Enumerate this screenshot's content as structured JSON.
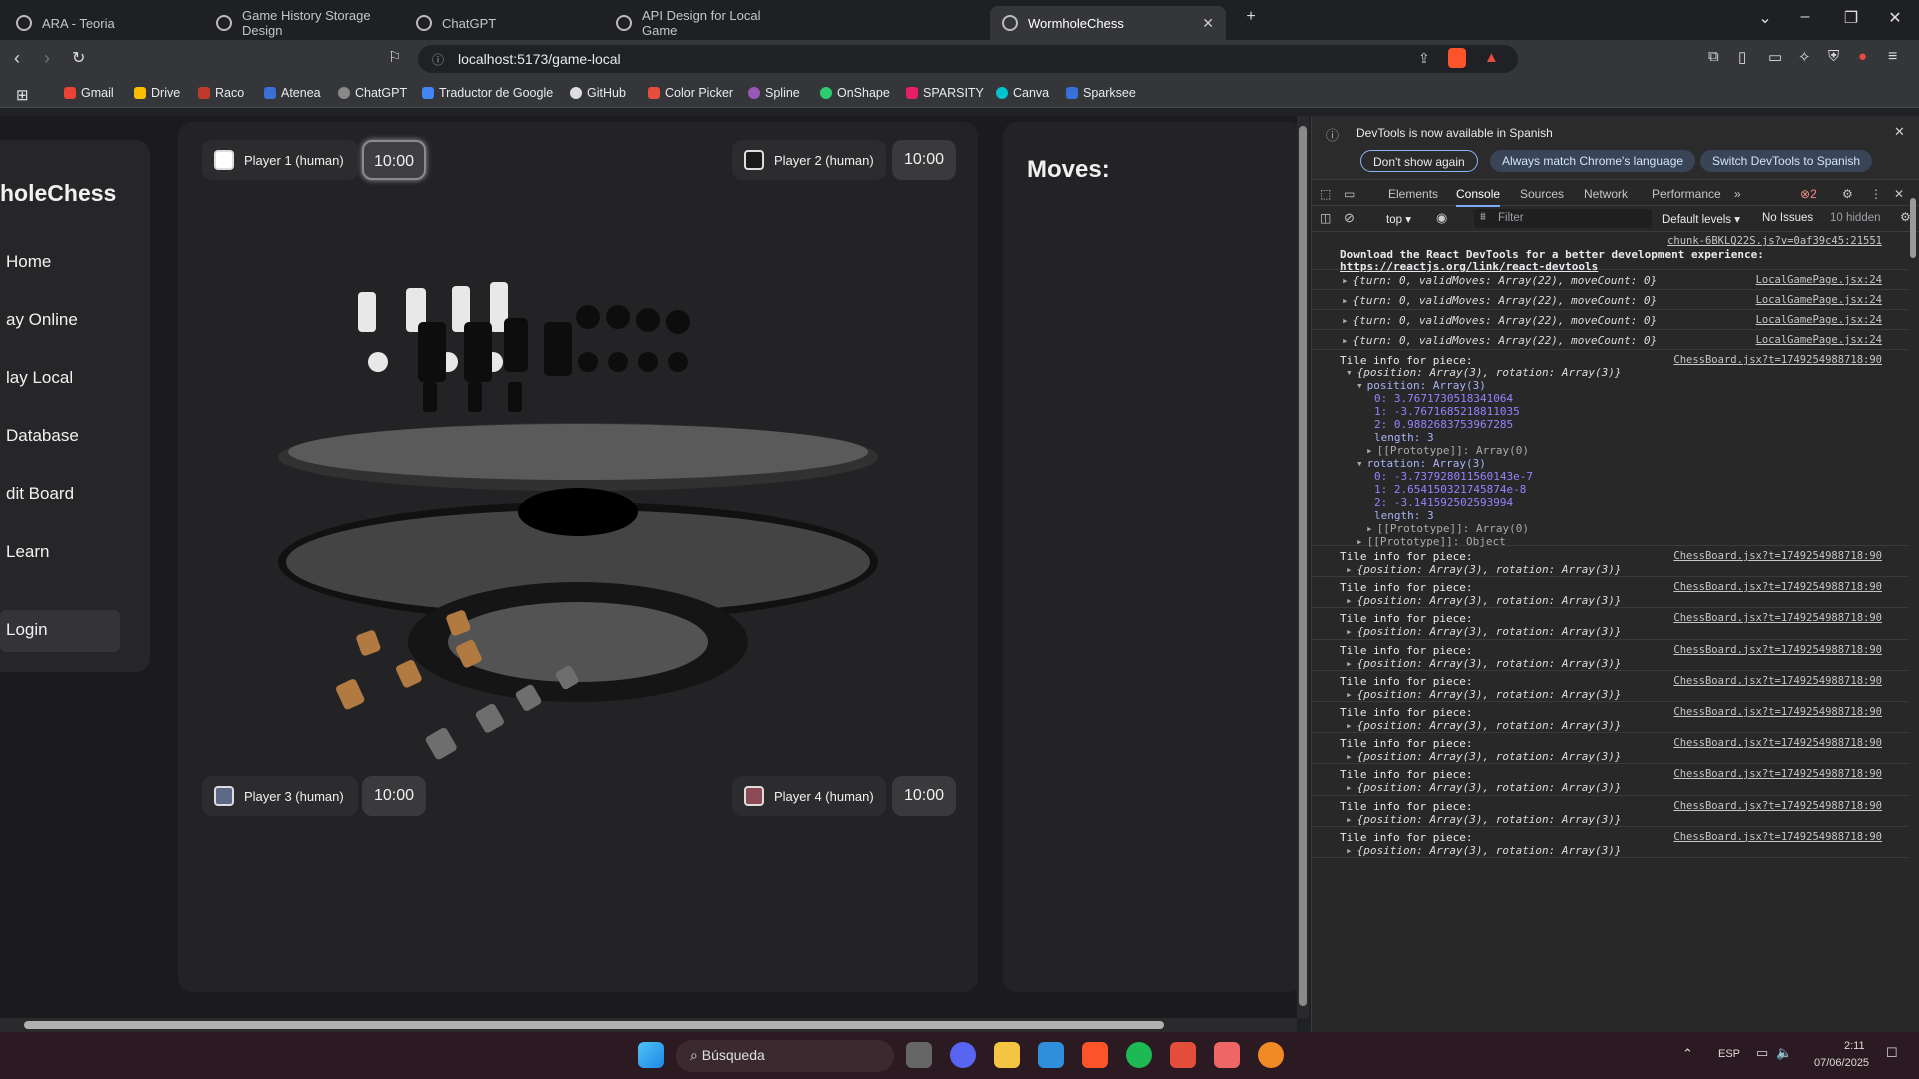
{
  "browser": {
    "tabs": [
      {
        "label": "ARA - Teoria"
      },
      {
        "label": "Game History Storage Design"
      },
      {
        "label": "ChatGPT"
      },
      {
        "label": "API Design for Local Game"
      },
      {
        "label": "WormholeChess"
      }
    ],
    "url": "localhost:5173/game-local",
    "bookmarks": [
      {
        "label": "Gmail"
      },
      {
        "label": "Drive"
      },
      {
        "label": "Raco"
      },
      {
        "label": "Atenea"
      },
      {
        "label": "ChatGPT"
      },
      {
        "label": "Traductor de Google"
      },
      {
        "label": "GitHub"
      },
      {
        "label": "Color Picker"
      },
      {
        "label": "Spline"
      },
      {
        "label": "OnShape"
      },
      {
        "label": "SPARSITY"
      },
      {
        "label": "Canva"
      },
      {
        "label": "Sparksee"
      }
    ]
  },
  "app": {
    "brand": "holeChess",
    "nav": [
      "Home",
      "ay Online",
      "lay Local",
      "Database",
      "dit Board",
      "Learn"
    ],
    "login": "Login",
    "players": [
      {
        "name": "Player 1 (human)",
        "time": "10:00",
        "color": "#ffffff"
      },
      {
        "name": "Player 2 (human)",
        "time": "10:00",
        "color": "#1a1a1a"
      },
      {
        "name": "Player 3 (human)",
        "time": "10:00",
        "color": "#5b6a85"
      },
      {
        "name": "Player 4 (human)",
        "time": "10:00",
        "color": "#8b4a55"
      }
    ],
    "moves_title": "Moves:"
  },
  "devtools": {
    "banner": "DevTools is now available in Spanish",
    "btn_dont_show": "Don't show again",
    "btn_match": "Always match Chrome's language",
    "btn_switch": "Switch DevTools to Spanish",
    "tabs": [
      "Elements",
      "Console",
      "Sources",
      "Network",
      "Performance"
    ],
    "error_count": "2",
    "context": "top",
    "filter_placeholder": "Filter",
    "levels": "Default levels",
    "issues": "No Issues",
    "hidden": "10 hidden",
    "react_src": "chunk-6BKLQ22S.js?v=0af39c45:21551",
    "react_msg1": "Download the React DevTools for a better development experience:",
    "react_msg2": "https://reactjs.org/link/react-devtools",
    "state_log": "{turn: 0, validMoves: Array(22), moveCount: 0}",
    "state_src": "LocalGamePage.jsx:24",
    "tile_label": "Tile info for piece:",
    "tile_obj": "{position: Array(3), rotation: Array(3)}",
    "tile_src": "ChessBoard.jsx?t=1749254988718:90",
    "position_head": "position: Array(3)",
    "pos": [
      "0: 3.7671730518341064",
      "1: -3.7671685218811035",
      "2: 0.9882683753967285"
    ],
    "length": "length: 3",
    "proto_arr": "[[Prototype]]: Array(0)",
    "rotation_head": "rotation: Array(3)",
    "rot": [
      "0: -3.737928011560143e-7",
      "1: 2.654150321745874e-8",
      "2: -3.141592502593994"
    ],
    "proto_obj": "[[Prototype]]: Object"
  },
  "taskbar": {
    "search": "Búsqueda",
    "lang": "ESP",
    "time": "2:11",
    "date": "07/06/2025"
  }
}
